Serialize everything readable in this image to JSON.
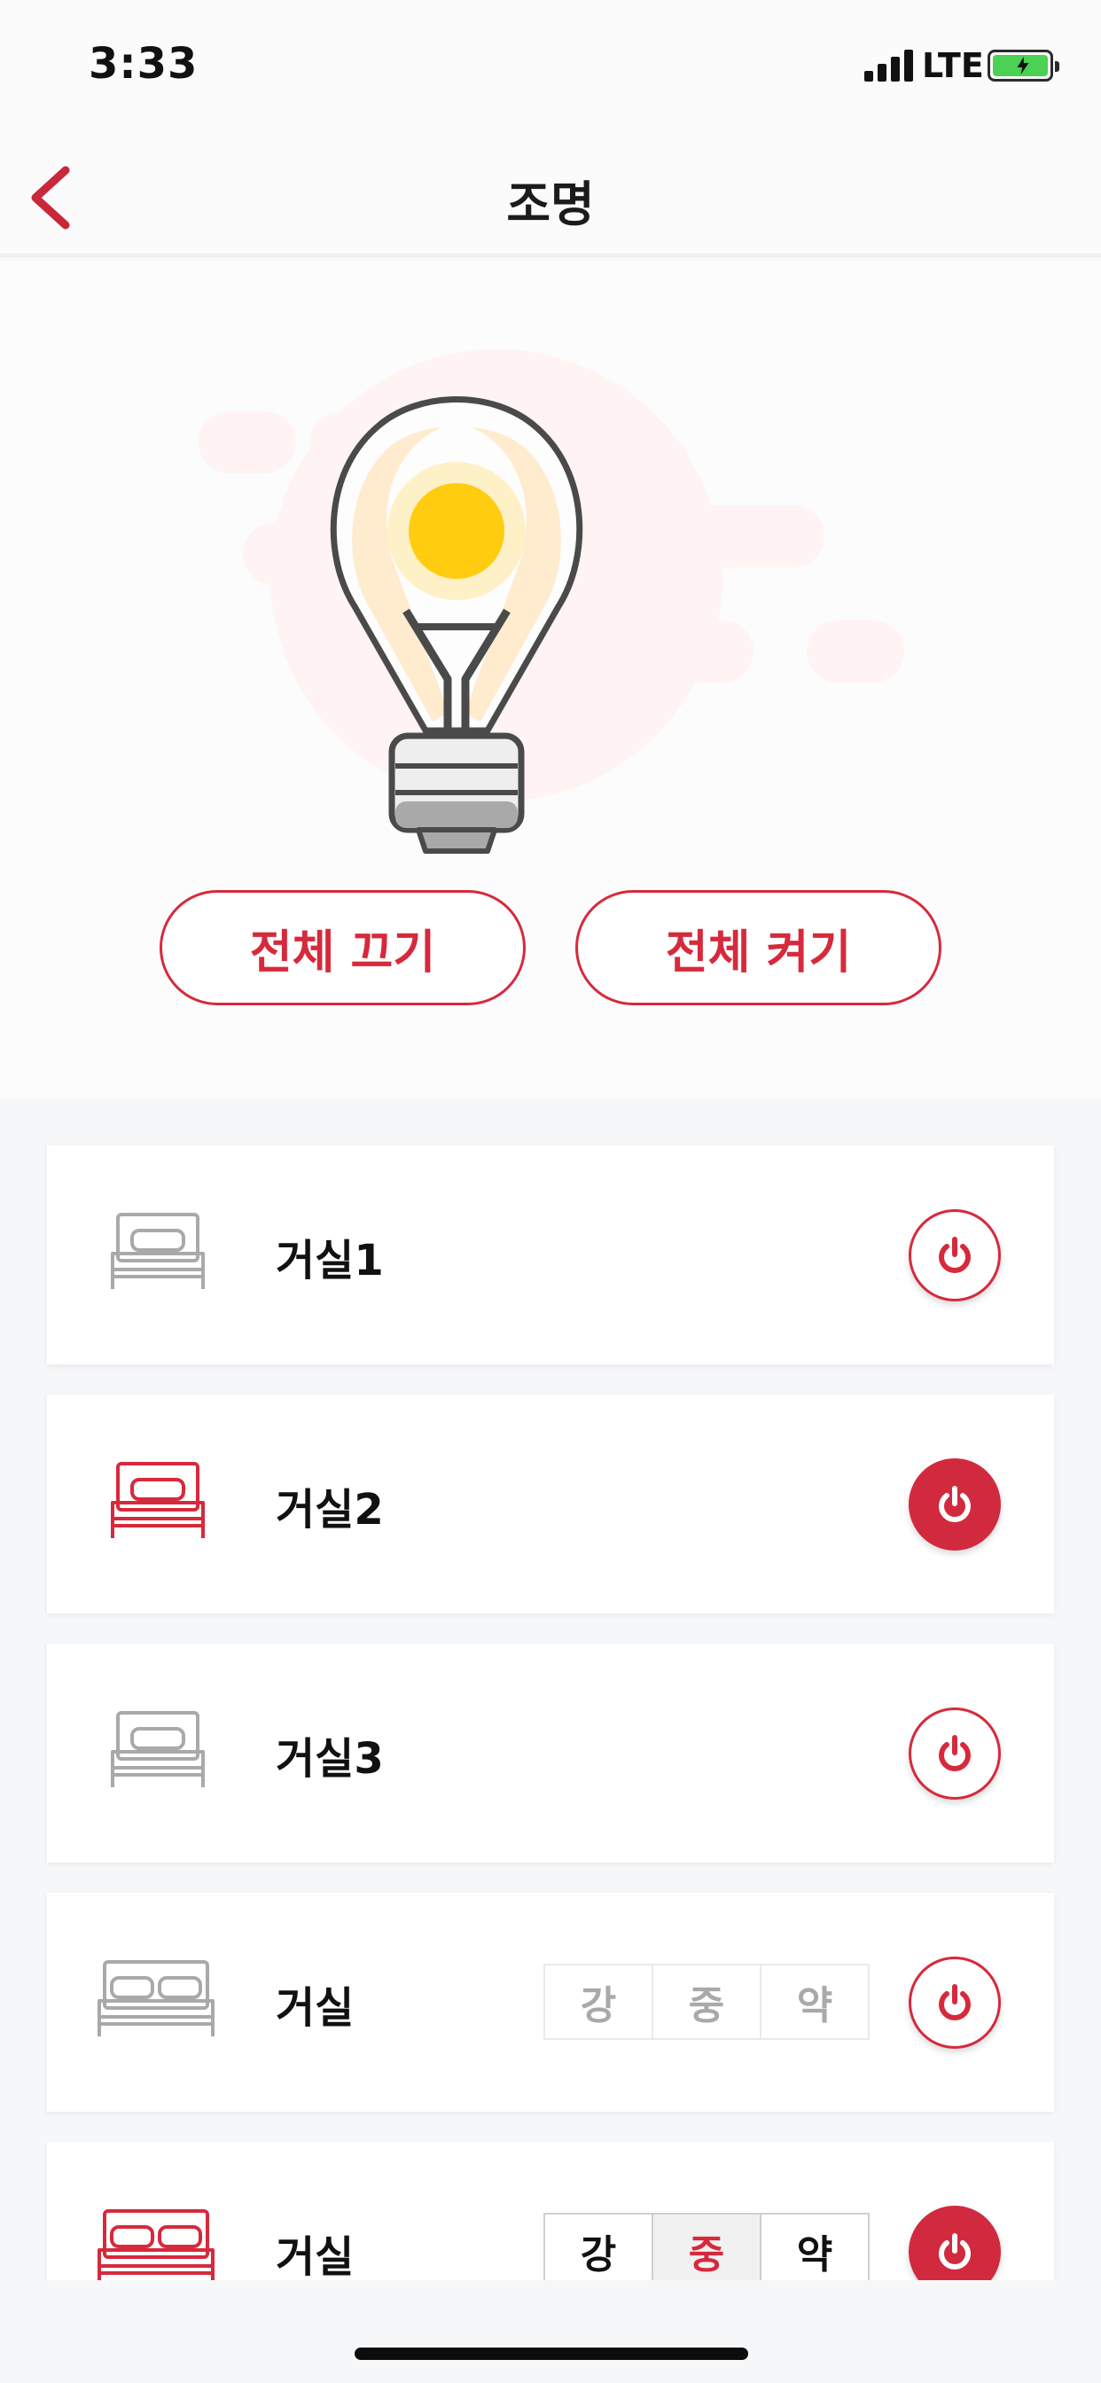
{
  "status": {
    "time": "3:33",
    "network": "LTE"
  },
  "nav": {
    "title": "조명",
    "back_icon": "chevron-left-icon"
  },
  "hero": {
    "icon": "lightbulb-icon",
    "all_off_label": "전체 끄기",
    "all_on_label": "전체 켜기"
  },
  "colors": {
    "accent": "#d62a3c",
    "bulb_glow": "#ffd21f",
    "inactive": "#a9a9a9"
  },
  "lights": [
    {
      "name": "거실1",
      "icon": "single-bed-icon",
      "on": false
    },
    {
      "name": "거실2",
      "icon": "single-bed-icon",
      "on": true
    },
    {
      "name": "거실3",
      "icon": "single-bed-icon",
      "on": false
    },
    {
      "name": "거실",
      "icon": "double-bed-icon",
      "on": false,
      "levels": [
        "강",
        "중",
        "약"
      ]
    },
    {
      "name": "거실",
      "icon": "double-bed-icon",
      "on": true,
      "levels": [
        "강",
        "중",
        "약"
      ],
      "selected_level": "중"
    }
  ]
}
